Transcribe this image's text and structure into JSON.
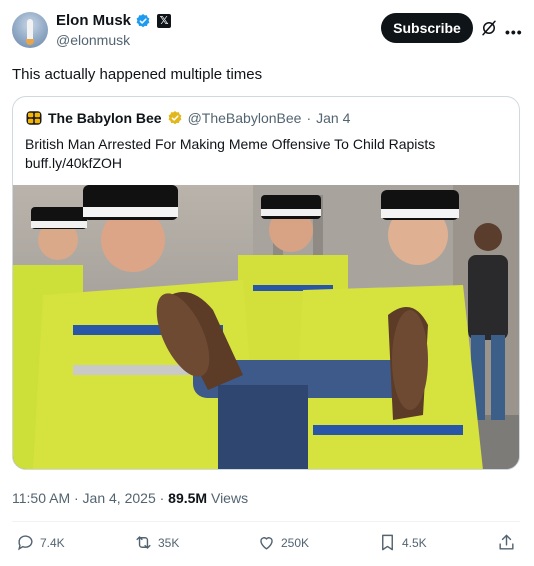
{
  "author": {
    "display_name": "Elon Musk",
    "handle": "@elonmusk",
    "avatar_icon": "rocket-avatar"
  },
  "header": {
    "subscribe_label": "Subscribe",
    "grok_icon": "grok-icon",
    "more_icon": "more-icon"
  },
  "post": {
    "text": "This actually happened multiple times"
  },
  "quote": {
    "name": "The Babylon Bee",
    "handle": "@TheBabylonBee",
    "separator": "·",
    "date": "Jan 4",
    "text": "British Man Arrested For Making Meme Offensive To Child Rapists",
    "link": "buff.ly/40kfZOH"
  },
  "meta": {
    "time": "11:50 AM · Jan 4, 2025 · ",
    "views_count": "89.5M",
    "views_label": " Views"
  },
  "actions": {
    "replies": "7.4K",
    "reposts": "35K",
    "likes": "250K",
    "bookmarks": "4.5K"
  },
  "colors": {
    "accent": "#1d9bf0",
    "text": "#0f1419",
    "muted": "#536471",
    "border": "#cfd9de",
    "gold": "#f4b400"
  }
}
